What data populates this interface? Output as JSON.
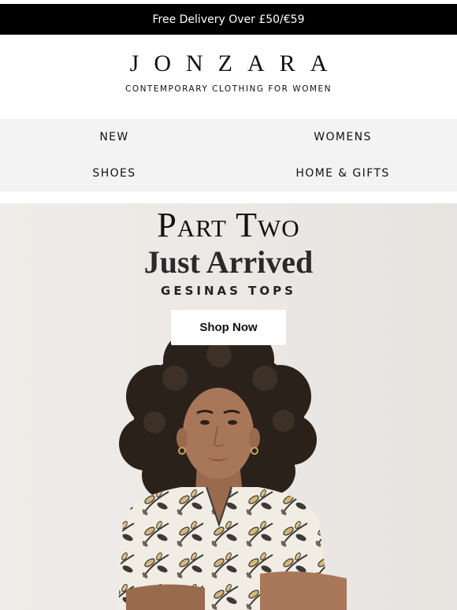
{
  "promo": {
    "text": "Free Delivery Over £50/€59"
  },
  "brand": {
    "logo": "JONZARA",
    "tagline": "CONTEMPORARY CLOTHING FOR WOMEN"
  },
  "nav": {
    "items": [
      {
        "label": "NEW"
      },
      {
        "label": "WOMENS"
      },
      {
        "label": "SHOES"
      },
      {
        "label": "HOME & GIFTS"
      }
    ]
  },
  "hero": {
    "title": "Part Two",
    "headline": "Just Arrived",
    "subtitle": "GESINAS TOPS",
    "cta": "Shop Now"
  },
  "colors": {
    "background": "#ffffff",
    "promo_bar": "#000000",
    "nav_bg": "#f3f3f3",
    "hero_bg": "#ece8e5",
    "text": "#111111"
  }
}
